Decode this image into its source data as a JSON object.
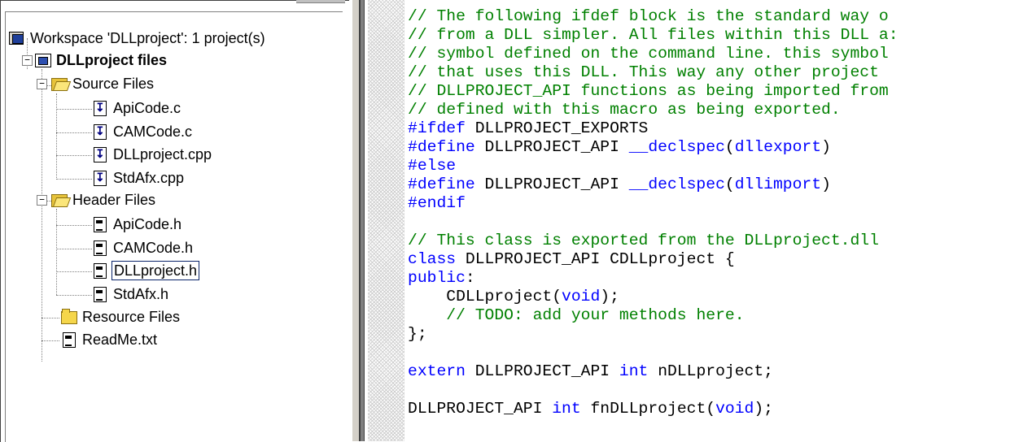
{
  "workspace_tree": {
    "workspace_label": "Workspace 'DLLproject': 1 project(s)",
    "project_label": "DLLproject files",
    "source_folder": {
      "label": "Source Files",
      "files": [
        "ApiCode.c",
        "CAMCode.c",
        "DLLproject.cpp",
        "StdAfx.cpp"
      ]
    },
    "header_folder": {
      "label": "Header Files",
      "files": [
        "ApiCode.h",
        "CAMCode.h",
        "DLLproject.h",
        "StdAfx.h"
      ]
    },
    "resource_folder": {
      "label": "Resource Files"
    },
    "readme": {
      "label": "ReadMe.txt"
    },
    "selected_file": "DLLproject.h"
  },
  "editor": {
    "lines": [
      [
        {
          "t": "comment",
          "v": "// The following ifdef block is the standard way o"
        }
      ],
      [
        {
          "t": "comment",
          "v": "// from a DLL simpler. All files within this DLL a:"
        }
      ],
      [
        {
          "t": "comment",
          "v": "// symbol defined on the command line. this symbol"
        }
      ],
      [
        {
          "t": "comment",
          "v": "// that uses this DLL. This way any other project "
        }
      ],
      [
        {
          "t": "comment",
          "v": "// DLLPROJECT_API functions as being imported from"
        }
      ],
      [
        {
          "t": "comment",
          "v": "// defined with this macro as being exported."
        }
      ],
      [
        {
          "t": "keyword",
          "v": "#ifdef"
        },
        {
          "t": "plain",
          "v": " DLLPROJECT_EXPORTS"
        }
      ],
      [
        {
          "t": "keyword",
          "v": "#define"
        },
        {
          "t": "plain",
          "v": " DLLPROJECT_API "
        },
        {
          "t": "keyword",
          "v": "__declspec"
        },
        {
          "t": "plain",
          "v": "("
        },
        {
          "t": "keyword",
          "v": "dllexport"
        },
        {
          "t": "plain",
          "v": ")"
        }
      ],
      [
        {
          "t": "keyword",
          "v": "#else"
        }
      ],
      [
        {
          "t": "keyword",
          "v": "#define"
        },
        {
          "t": "plain",
          "v": " DLLPROJECT_API "
        },
        {
          "t": "keyword",
          "v": "__declspec"
        },
        {
          "t": "plain",
          "v": "("
        },
        {
          "t": "keyword",
          "v": "dllimport"
        },
        {
          "t": "plain",
          "v": ")"
        }
      ],
      [
        {
          "t": "keyword",
          "v": "#endif"
        }
      ],
      [],
      [
        {
          "t": "comment",
          "v": "// This class is exported from the DLLproject.dll"
        }
      ],
      [
        {
          "t": "keyword",
          "v": "class"
        },
        {
          "t": "plain",
          "v": " DLLPROJECT_API CDLLproject {"
        }
      ],
      [
        {
          "t": "keyword",
          "v": "public"
        },
        {
          "t": "plain",
          "v": ":"
        }
      ],
      [
        {
          "t": "plain",
          "v": "    CDLLproject("
        },
        {
          "t": "keyword",
          "v": "void"
        },
        {
          "t": "plain",
          "v": ");"
        }
      ],
      [
        {
          "t": "plain",
          "v": "    "
        },
        {
          "t": "comment",
          "v": "// TODO: add your methods here."
        }
      ],
      [
        {
          "t": "plain",
          "v": "};"
        }
      ],
      [],
      [
        {
          "t": "keyword",
          "v": "extern"
        },
        {
          "t": "plain",
          "v": " DLLPROJECT_API "
        },
        {
          "t": "keyword",
          "v": "int"
        },
        {
          "t": "plain",
          "v": " nDLLproject;"
        }
      ],
      [],
      [
        {
          "t": "plain",
          "v": "DLLPROJECT_API "
        },
        {
          "t": "keyword",
          "v": "int"
        },
        {
          "t": "plain",
          "v": " fnDLLproject("
        },
        {
          "t": "keyword",
          "v": "void"
        },
        {
          "t": "plain",
          "v": ");"
        }
      ]
    ]
  },
  "icons": {
    "workspace": "workspace-icon",
    "project": "project-icon",
    "folder_open": "open-folder-icon",
    "folder_closed": "folder-icon",
    "source_file": "cpp-file-icon",
    "header_file": "header-file-icon",
    "text_file": "text-file-icon"
  },
  "colors": {
    "comment": "#008000",
    "keyword": "#0000ff",
    "plain": "#000000",
    "selection_border": "#0a246a"
  }
}
